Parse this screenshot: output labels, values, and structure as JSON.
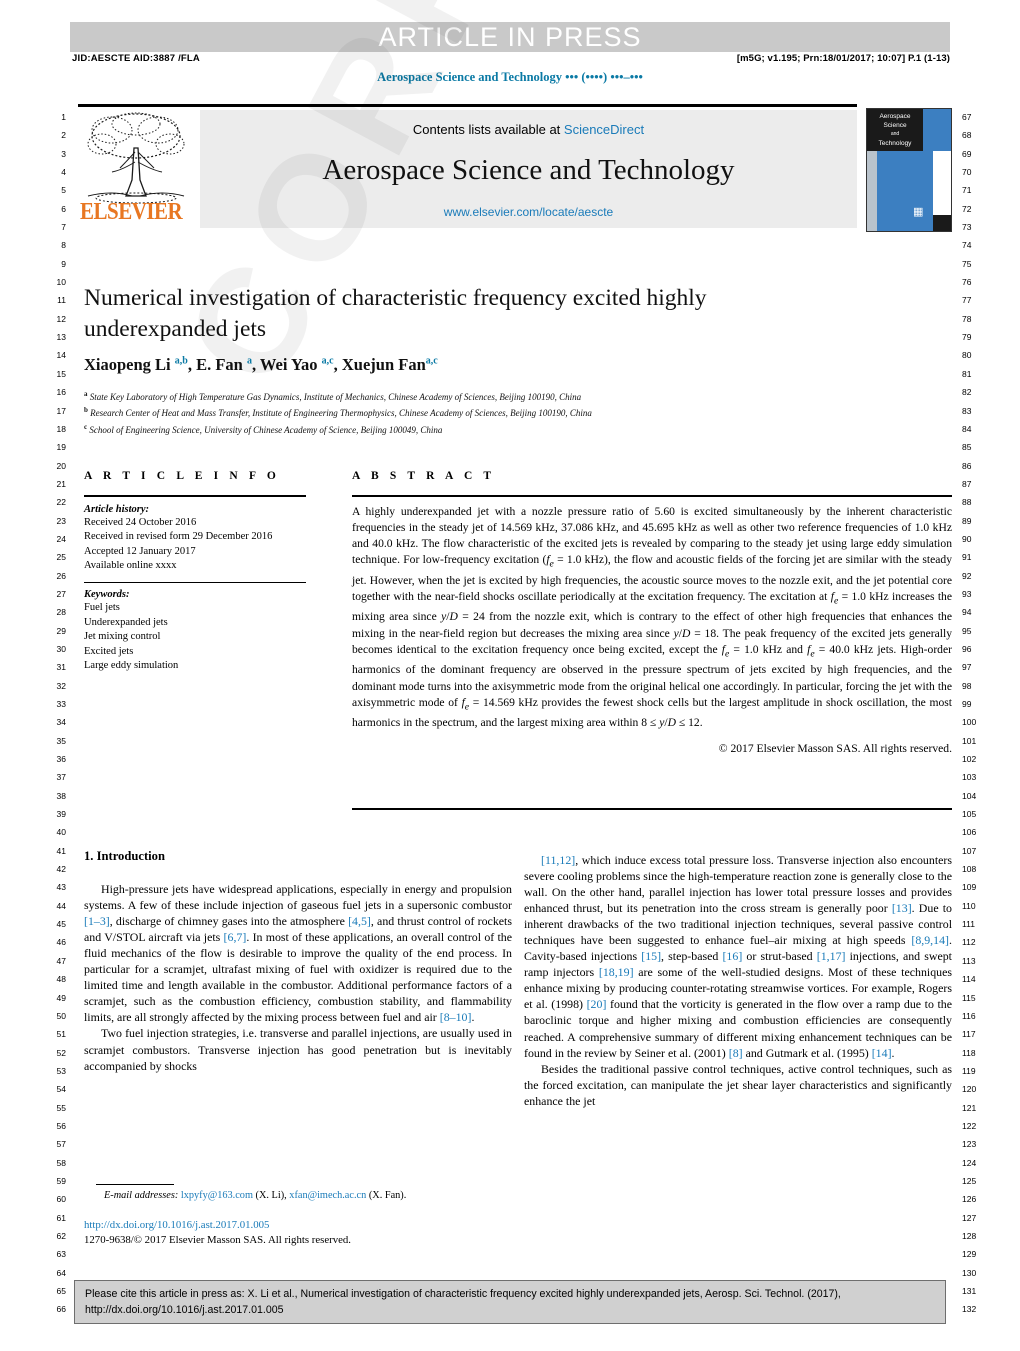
{
  "banner": {
    "press_label": "ARTICLE IN PRESS",
    "jid_line": "JID:AESCTE    AID:3887 /FLA",
    "prn_line": "[m5G; v1.195; Prn:18/01/2017; 10:07] P.1 (1-13)",
    "running_head": "Aerospace Science and Technology ••• (••••) •••–•••"
  },
  "masthead": {
    "publisher": "ELSEVIER",
    "contents_prefix": "Contents lists available at ",
    "contents_link": "ScienceDirect",
    "journal_title": "Aerospace Science and Technology",
    "journal_url": "www.elsevier.com/locate/aescte",
    "cover_line1": "Aerospace",
    "cover_line2": "Science",
    "cover_line3": "and",
    "cover_line4": "Technology"
  },
  "article": {
    "title": "Numerical investigation of characteristic frequency excited highly underexpanded jets",
    "authors_html": "Xiaopeng Li <sup>a,b</sup>, E. Fan <sup>a</sup>, Wei Yao <sup>a,c</sup>, Xuejun Fan<sup>a,c</sup>",
    "affiliations": [
      {
        "marker": "a",
        "text": "State Key Laboratory of High Temperature Gas Dynamics, Institute of Mechanics, Chinese Academy of Sciences, Beijing 100190, China"
      },
      {
        "marker": "b",
        "text": "Research Center of Heat and Mass Transfer, Institute of Engineering Thermophysics, Chinese Academy of Sciences, Beijing 100190, China"
      },
      {
        "marker": "c",
        "text": "School of Engineering Science, University of Chinese Academy of Science, Beijing 100049, China"
      }
    ]
  },
  "article_info": {
    "heading": "A R T I C L E   I N F O",
    "history_label": "Article history:",
    "history": [
      "Received 24 October 2016",
      "Received in revised form 29 December 2016",
      "Accepted 12 January 2017",
      "Available online xxxx"
    ],
    "keywords_label": "Keywords:",
    "keywords": [
      "Fuel jets",
      "Underexpanded jets",
      "Jet mixing control",
      "Excited jets",
      "Large eddy simulation"
    ]
  },
  "abstract": {
    "heading": "A B S T R A C T",
    "body_html": "A highly underexpanded jet with a nozzle pressure ratio of 5.60 is excited simultaneously by the inherent characteristic frequencies in the steady jet of 14.569 kHz, 37.086 kHz, and 45.695 kHz as well as other two reference frequencies of 1.0 kHz and 40.0 kHz. The flow characteristic of the excited jets is revealed by comparing to the steady jet using large eddy simulation technique. For low-frequency excitation (<i>f<sub>e</sub></i> = 1.0 kHz), the flow and acoustic fields of the forcing jet are similar with the steady jet. However, when the jet is excited by high frequencies, the acoustic source moves to the nozzle exit, and the jet potential core together with the near-field shocks oscillate periodically at the excitation frequency. The excitation at <i>f<sub>e</sub></i> = 1.0 kHz increases the mixing area since <i>y</i>/<i>D</i> = 24 from the nozzle exit, which is contrary to the effect of other high frequencies that enhances the mixing in the near-field region but decreases the mixing area since <i>y</i>/<i>D</i> = 18. The peak frequency of the excited jets generally becomes identical to the excitation frequency once being excited, except the <i>f<sub>e</sub></i> = 1.0 kHz and <i>f<sub>e</sub></i> = 40.0 kHz jets. High-order harmonics of the dominant frequency are observed in the pressure spectrum of jets excited by high frequencies, and the dominant mode turns into the axisymmetric mode from the original helical one accordingly. In particular, forcing the jet with the axisymmetric mode of <i>f<sub>e</sub></i> = 14.569 kHz provides the fewest shock cells but the largest amplitude in shock oscillation, the most harmonics in the spectrum, and the largest mixing area within 8 ≤ <i>y</i>/<i>D</i> ≤ 12.",
    "copyright": "© 2017 Elsevier Masson SAS. All rights reserved."
  },
  "main": {
    "section_heading": "1. Introduction",
    "left_paragraphs_html": [
      "High-pressure jets have widespread applications, especially in energy and propulsion systems. A few of these include injection of gaseous fuel jets in a supersonic combustor <span class=\"ref\">[1–3]</span>, discharge of chimney gases into the atmosphere <span class=\"ref\">[4,5]</span>, and thrust control of rockets and V/STOL aircraft via jets <span class=\"ref\">[6,7]</span>. In most of these applications, an overall control of the fluid mechanics of the flow is desirable to improve the quality of the end process. In particular for a scramjet, ultrafast mixing of fuel with oxidizer is required due to the limited time and length available in the combustor. Additional performance factors of a scramjet, such as the combustion efficiency, combustion stability, and flammability limits, are all strongly affected by the mixing process between fuel and air <span class=\"ref\">[8–10]</span>.",
      "Two fuel injection strategies, i.e. transverse and parallel injections, are usually used in scramjet combustors. Transverse injection has good penetration but is inevitably accompanied by shocks"
    ],
    "right_paragraphs_html": [
      "<span class=\"ref\">[11,12]</span>, which induce excess total pressure loss. Transverse injection also encounters severe cooling problems since the high-temperature reaction zone is generally close to the wall. On the other hand, parallel injection has lower total pressure losses and provides enhanced thrust, but its penetration into the cross stream is generally poor <span class=\"ref\">[13]</span>. Due to inherent drawbacks of the two traditional injection techniques, several passive control techniques have been suggested to enhance fuel–air mixing at high speeds <span class=\"ref\">[8,9,14]</span>. Cavity-based injections <span class=\"ref\">[15]</span>, step-based <span class=\"ref\">[16]</span> or strut-based <span class=\"ref\">[1,17]</span> injections, and swept ramp injectors <span class=\"ref\">[18,19]</span> are some of the well-studied designs. Most of these techniques enhance mixing by producing counter-rotating streamwise vortices. For example, Rogers et al. (1998) <span class=\"ref\">[20]</span> found that the vorticity is generated in the flow over a ramp due to the baroclinic torque and higher mixing and combustion efficiencies are consequently reached. A comprehensive summary of different mixing enhancement techniques can be found in the review by Seiner et al. (2001) <span class=\"ref\">[8]</span> and Gutmark et al. (1995) <span class=\"ref\">[14]</span>.",
      "Besides the traditional passive control techniques, active control techniques, such as the forced excitation, can manipulate the jet shear layer characteristics and significantly enhance the jet"
    ]
  },
  "footer": {
    "email_label": "E-mail addresses:",
    "email1": "lxpyfy@163.com",
    "email1_owner": "(X. Li),",
    "email2": "xfan@imech.ac.cn",
    "email2_owner": "(X. Fan).",
    "doi": "http://dx.doi.org/10.1016/j.ast.2017.01.005",
    "issn": "1270-9638/© 2017 Elsevier Masson SAS. All rights reserved."
  },
  "cite_box": {
    "line1": "Please cite this article in press as: X. Li et al., Numerical investigation of characteristic frequency excited highly underexpanded jets, Aerosp. Sci. Technol. (2017),",
    "line2": "http://dx.doi.org/10.1016/j.ast.2017.01.005"
  },
  "watermark": "CORRECTED PROOF",
  "line_numbers": {
    "left_start": 1,
    "left_end": 66,
    "right_start": 67,
    "right_end": 132
  },
  "colors": {
    "link": "#1a7bb9",
    "elsevier_orange": "#E87722",
    "banner_gray": "#c9c9c9",
    "masthead_gray": "#ececec",
    "cite_gray": "#d0d0d0"
  }
}
